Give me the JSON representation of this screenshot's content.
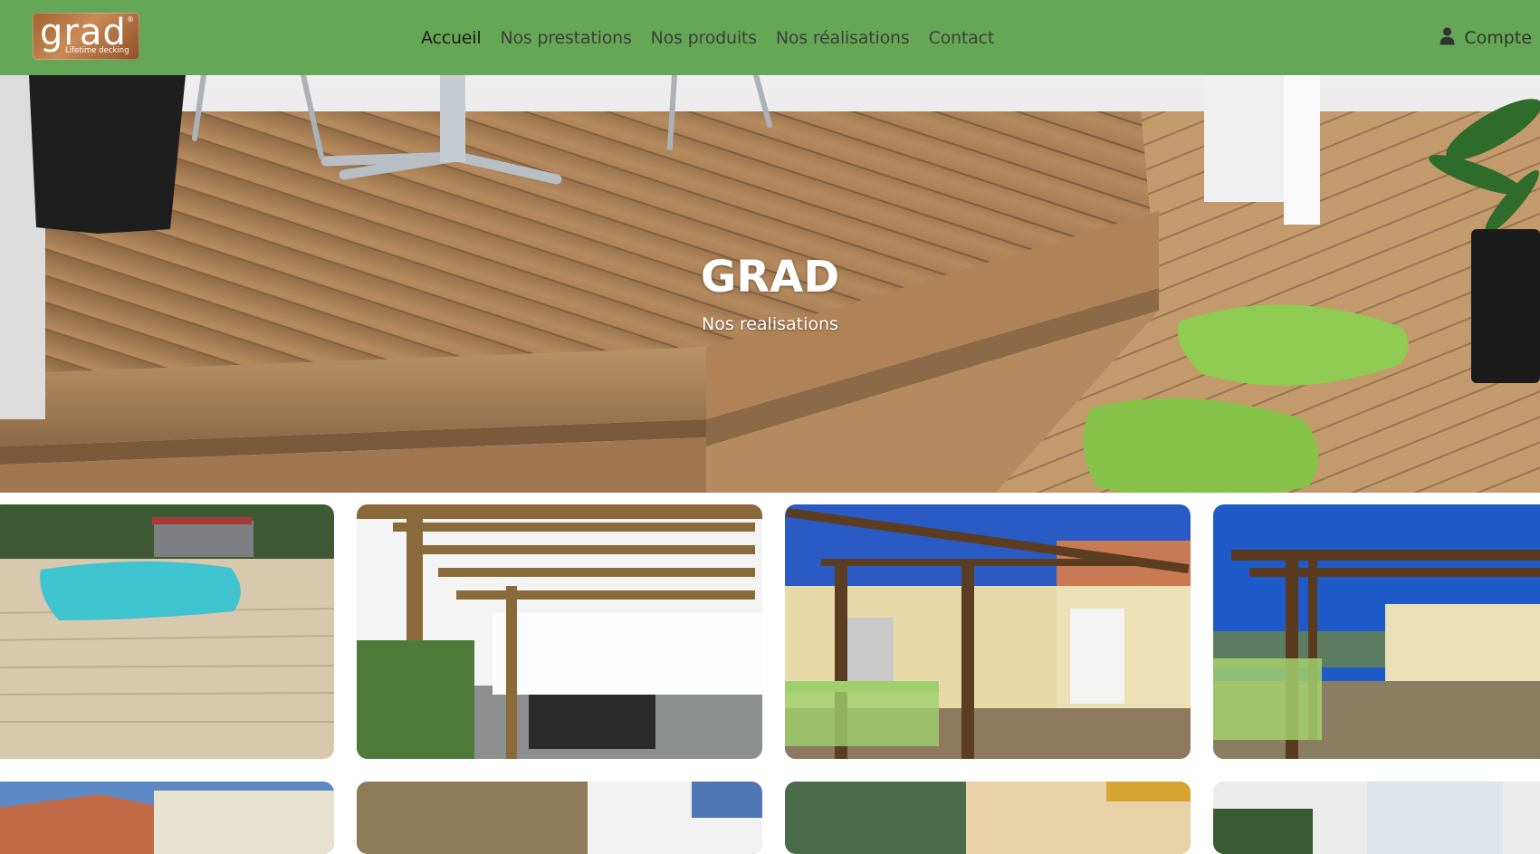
{
  "navbar": {
    "logo": {
      "word": "grad",
      "tagline": "Lifetime decking",
      "mark": "®"
    },
    "links": [
      {
        "label": "Accueil",
        "active": true
      },
      {
        "label": "Nos prestations",
        "active": false
      },
      {
        "label": "Nos produits",
        "active": false
      },
      {
        "label": "Nos réalisations",
        "active": false
      },
      {
        "label": "Contact",
        "active": false
      }
    ],
    "account": {
      "label": "Compte",
      "icon": "user-icon"
    }
  },
  "hero": {
    "title": "GRAD",
    "subtitle": "Nos realisations"
  },
  "gallery": {
    "photos": [
      {
        "subject": "pool-deck"
      },
      {
        "subject": "pergola-terrace"
      },
      {
        "subject": "pergola-house"
      },
      {
        "subject": "pergola-garden"
      },
      {
        "subject": "house-roof"
      },
      {
        "subject": "garden-wall"
      },
      {
        "subject": "house-awning"
      },
      {
        "subject": "house-window"
      }
    ]
  },
  "colors": {
    "navbar": "#66a756",
    "wood": "#b58a5e",
    "cushion": "#8fca52"
  }
}
